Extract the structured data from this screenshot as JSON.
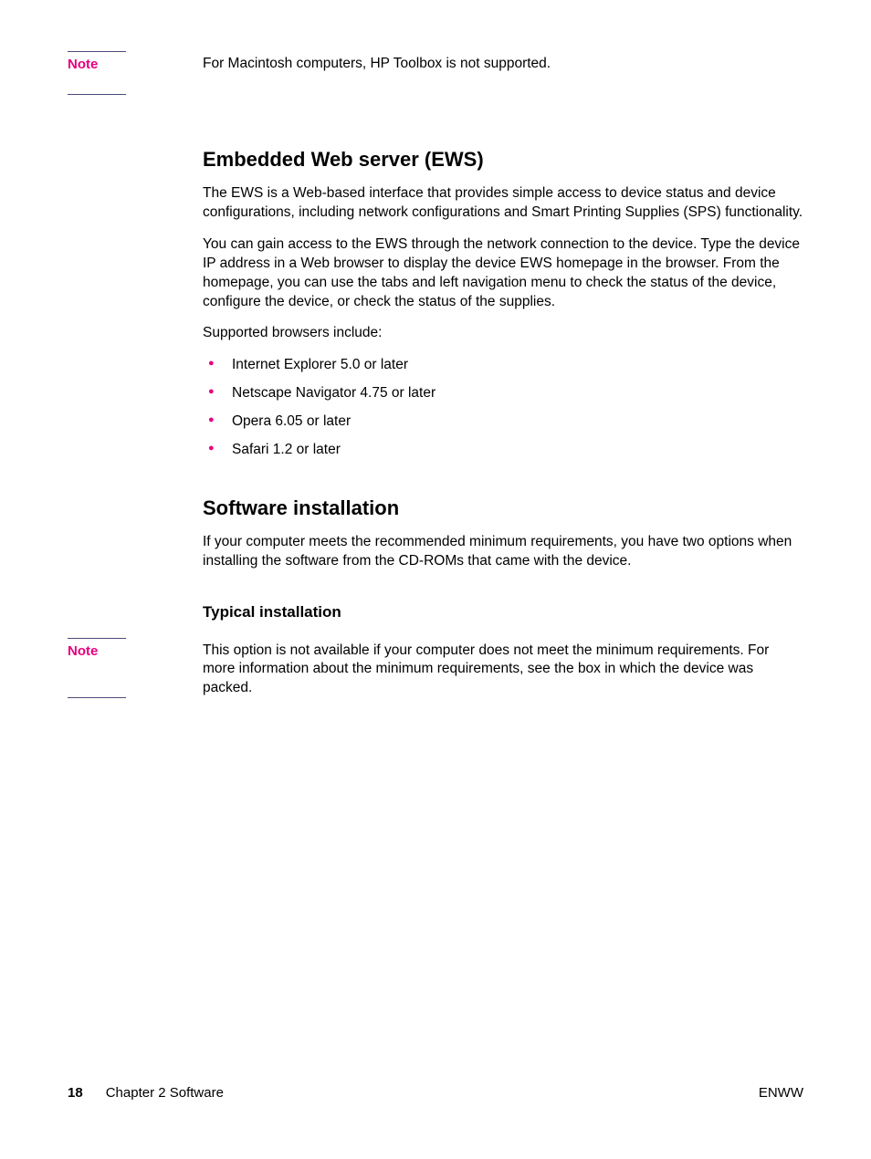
{
  "note1": {
    "label": "Note",
    "text": "For Macintosh computers, HP Toolbox is not supported."
  },
  "ews": {
    "heading": "Embedded Web server (EWS)",
    "p1": "The EWS is a Web-based interface that provides simple access to device status and device configurations, including network configurations and Smart Printing Supplies (SPS) functionality.",
    "p2": "You can gain access to the EWS through the network connection to the device. Type the device IP address in a Web browser to display the device EWS homepage in the browser. From the homepage, you can use the tabs and left navigation menu to check the status of the device, configure the device, or check the status of the supplies.",
    "p3": "Supported browsers include:",
    "bullets": [
      "Internet Explorer 5.0 or later",
      "Netscape Navigator 4.75 or later",
      "Opera 6.05 or later",
      "Safari 1.2 or later"
    ]
  },
  "install": {
    "heading": "Software installation",
    "p1": "If your computer meets the recommended minimum requirements, you have two options when installing the software from the CD-ROMs that came with the device.",
    "sub": "Typical installation"
  },
  "note2": {
    "label": "Note",
    "text": "This option is not available if your computer does not meet the minimum requirements. For more information about the minimum requirements, see the box in which the device was packed."
  },
  "footer": {
    "page": "18",
    "chapter": "Chapter 2  Software",
    "right": "ENWW"
  }
}
